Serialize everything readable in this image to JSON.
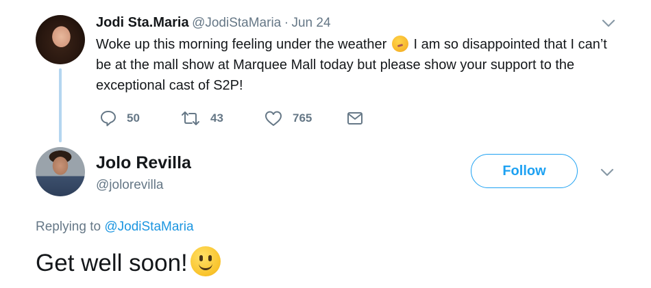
{
  "tweet1": {
    "display_name": "Jodi Sta.Maria",
    "handle": "@JodiStaMaria",
    "separator": "·",
    "date": "Jun 24",
    "text_before_emoji": "Woke up this morning feeling under the weather",
    "emoji": "sick-face",
    "text_after_emoji": "I am so disappointed that I can’t be at the mall show at Marquee Mall today but please show your support to the exceptional cast of S2P!",
    "replies_count": "50",
    "retweets_count": "43",
    "likes_count": "765"
  },
  "tweet2": {
    "display_name": "Jolo Revilla",
    "handle": "@jolorevilla",
    "follow_label": "Follow",
    "replying_prefix": "Replying to",
    "replying_to": "@JodiStaMaria",
    "text": "Get well soon!",
    "emoji": "slightly-smiling-face"
  },
  "colors": {
    "accent": "#1da1f2",
    "muted_text": "#657786",
    "thread_line": "#b4d6f0",
    "primary_text": "#14171a"
  }
}
